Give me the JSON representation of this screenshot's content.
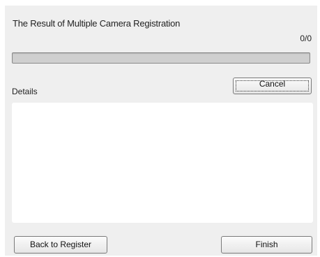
{
  "dialog": {
    "title": "The Result of Multiple Camera Registration",
    "counter": "0/0",
    "progress": 0
  },
  "buttons": {
    "cancel_label": "Cancel",
    "back_label": "Back to Register",
    "finish_label": "Finish"
  },
  "details": {
    "label": "Details",
    "content": ""
  }
}
